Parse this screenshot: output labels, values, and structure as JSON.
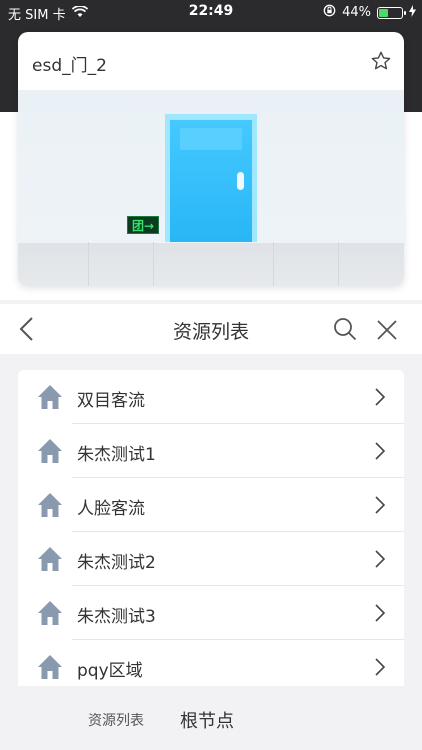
{
  "status_bar": {
    "carrier": "无 SIM 卡",
    "time": "22:49",
    "battery_percent": "44%",
    "battery_level": 0.44,
    "battery_color": "#4cd964"
  },
  "preview": {
    "title": "esd_门_2",
    "star_icon": "star-outline-icon",
    "exit_sign_text": "团→"
  },
  "nav": {
    "title": "资源列表",
    "back_icon": "chevron-left-icon",
    "search_icon": "search-icon",
    "close_icon": "close-icon"
  },
  "list": {
    "items": [
      {
        "label": "双目客流"
      },
      {
        "label": "朱杰测试1"
      },
      {
        "label": "人脸客流"
      },
      {
        "label": "朱杰测试2"
      },
      {
        "label": "朱杰测试3"
      },
      {
        "label": "pqy区域"
      }
    ]
  },
  "breadcrumb": {
    "items": [
      "资源列表",
      "根节点"
    ]
  }
}
